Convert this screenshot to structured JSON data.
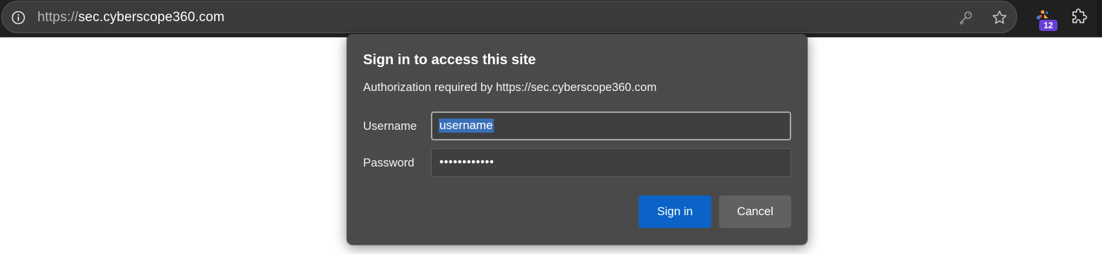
{
  "browser": {
    "url_scheme": "https://",
    "url_host": "sec.cyberscope360.com",
    "extension_badge_count": "12",
    "icons": [
      "info-icon",
      "key-icon",
      "star-icon",
      "extension-activity-icon",
      "puzzle-icon"
    ]
  },
  "dialog": {
    "title": "Sign in to access this site",
    "subtitle": "Authorization required by https://sec.cyberscope360.com",
    "username_label": "Username",
    "username_value": "username",
    "password_label": "Password",
    "password_value": "••••••••••••",
    "signin_label": "Sign in",
    "cancel_label": "Cancel"
  },
  "colors": {
    "dialog_bg": "#4a4a4a",
    "primary_button": "#0b63c7",
    "selection": "#3a6fb8",
    "badge": "#6b3fd6"
  }
}
